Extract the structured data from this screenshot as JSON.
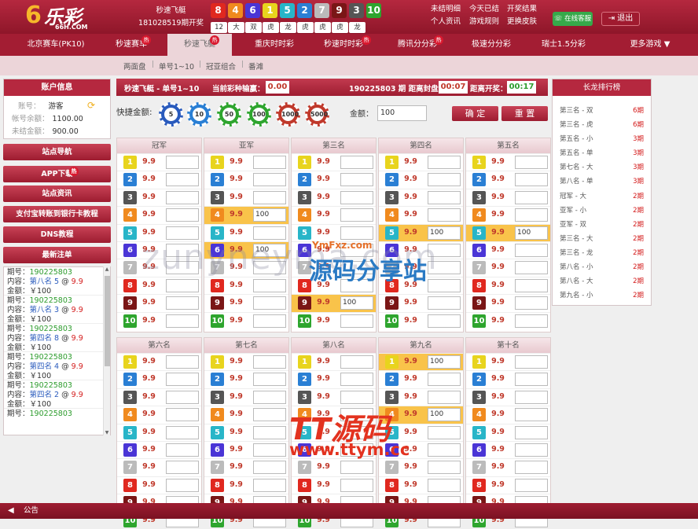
{
  "header": {
    "logo_text": "乐彩",
    "logo_url": "66H.COM",
    "game_name": "秒速飞艇",
    "period_open": "181028519期开奖",
    "result_numbers": [
      "8",
      "4",
      "6",
      "1",
      "5",
      "2",
      "7",
      "9",
      "3",
      "10"
    ],
    "result_labels": [
      "12",
      "大",
      "双",
      "虎",
      "龙",
      "虎",
      "虎",
      "虎",
      "龙"
    ],
    "links_col1": [
      "未结明细",
      "个人资讯"
    ],
    "links_col2": [
      "今天已结",
      "游戏规则"
    ],
    "links_col3": [
      "开奖结果",
      "更换皮肤"
    ],
    "service_label": "在线客服",
    "logout_label": "退出"
  },
  "nav": {
    "items": [
      "北京赛车(PK10)",
      "秒速赛车",
      "秒速飞艇",
      "重庆时时彩",
      "秒速时时彩",
      "腾讯分分彩",
      "极速分分彩",
      "瑞士1.5分彩",
      "更多游戏 ▼"
    ],
    "hot_badge": "热",
    "active": "秒速飞艇"
  },
  "subnav": {
    "items": [
      "两面盘",
      "单号1~10",
      "冠亚组合",
      "番滩"
    ]
  },
  "account": {
    "title": "账户信息",
    "account_label": "账号：",
    "account_value": "游客",
    "balance_label": "帐号余额：",
    "balance_value": "1100.00",
    "unsettled_label": "未结金额：",
    "unsettled_value": "900.00"
  },
  "side_menu": [
    "站点导航",
    "APP下载",
    "站点资讯",
    "支付宝转账到银行卡教程",
    "DNS教程",
    "最新注单"
  ],
  "orders": [
    {
      "period": "190225803",
      "content": "第八名 5",
      "odds": "9.9",
      "amount": "￥100"
    },
    {
      "period": "190225803",
      "content": "第八名 3",
      "odds": "9.9",
      "amount": "￥100"
    },
    {
      "period": "190225803",
      "content": "第四名 8",
      "odds": "9.9",
      "amount": "￥100"
    },
    {
      "period": "190225803",
      "content": "第四名 4",
      "odds": "9.9",
      "amount": "￥100"
    },
    {
      "period": "190225803",
      "content": "第四名 2",
      "odds": "9.9",
      "amount": "￥100"
    },
    {
      "period": "190225803",
      "content": "",
      "odds": "",
      "amount": ""
    }
  ],
  "order_labels": {
    "period": "期号：",
    "content": "内容：",
    "amount": "金额："
  },
  "info_bar": {
    "game": "秒速飞艇 - 单号1~10",
    "profit_label": "当前彩种输赢：",
    "profit": "0.00",
    "period": "190225803 期 距离封盘：",
    "close_time": "00:07",
    "open_label": "距离开奖：",
    "open_time": "00:17"
  },
  "quick": {
    "label": "快捷金额:",
    "chips": [
      "5",
      "10",
      "50",
      "100",
      "1000",
      "5000"
    ],
    "amount_label": "金额：",
    "amount_value": "100",
    "confirm": "确 定",
    "reset": "重 置"
  },
  "groups": [
    {
      "title": "冠军",
      "sel": {}
    },
    {
      "title": "亚军",
      "sel": {
        "4": "100",
        "6": "100"
      }
    },
    {
      "title": "第三名",
      "sel": {
        "9": "100"
      }
    },
    {
      "title": "第四名",
      "sel": {
        "5": "100"
      }
    },
    {
      "title": "第五名",
      "sel": {
        "5": "100"
      }
    },
    {
      "title": "第六名",
      "sel": {}
    },
    {
      "title": "第七名",
      "sel": {}
    },
    {
      "title": "第八名",
      "sel": {}
    },
    {
      "title": "第九名",
      "sel": {
        "1": "100",
        "4": "100"
      }
    },
    {
      "title": "第十名",
      "sel": {}
    }
  ],
  "odds": "9.9",
  "ball_colors": {
    "1": "#e8d41d",
    "2": "#2a7fd4",
    "3": "#555555",
    "4": "#f08a1e",
    "5": "#28b5c8",
    "6": "#4a35d6",
    "7": "#bbbbbb",
    "8": "#e0281f",
    "9": "#7a1616",
    "10": "#2ea52e"
  },
  "changlong": {
    "title": "长龙排行榜",
    "items": [
      {
        "name": "第三名 - 双",
        "count": "6期"
      },
      {
        "name": "第三名 - 虎",
        "count": "6期"
      },
      {
        "name": "第五名 - 小",
        "count": "3期"
      },
      {
        "name": "第五名 - 单",
        "count": "3期"
      },
      {
        "name": "第七名 - 大",
        "count": "3期"
      },
      {
        "name": "第八名 - 单",
        "count": "3期"
      },
      {
        "name": "冠军 - 大",
        "count": "2期"
      },
      {
        "name": "亚军 - 小",
        "count": "2期"
      },
      {
        "name": "亚军 - 双",
        "count": "2期"
      },
      {
        "name": "第三名 - 大",
        "count": "2期"
      },
      {
        "name": "第三名 - 龙",
        "count": "2期"
      },
      {
        "name": "第八名 - 小",
        "count": "2期"
      },
      {
        "name": "第八名 - 大",
        "count": "2期"
      },
      {
        "name": "第九名 - 小",
        "count": "2期"
      }
    ]
  },
  "footer": {
    "notice": "公告"
  },
  "watermarks": {
    "w1": "zunyneyma.com",
    "w2": "YmFxz.com",
    "w3": "源码分享站",
    "w4": "TT源码",
    "w5": "www.ttym.cc"
  }
}
